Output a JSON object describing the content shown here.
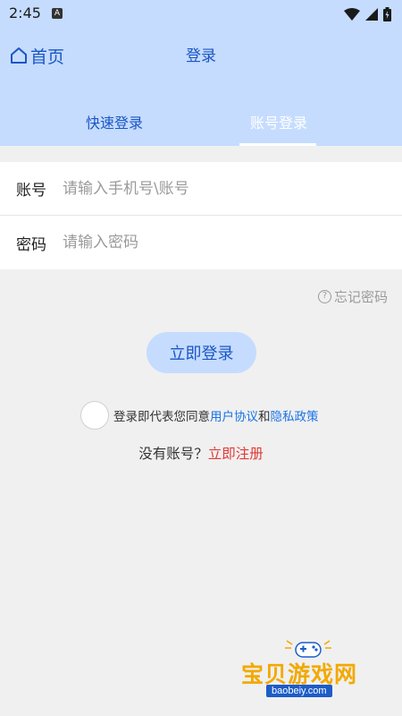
{
  "status_bar": {
    "time": "2:45",
    "notification_badge": "A",
    "icons": [
      "wifi-icon",
      "signal-icon",
      "battery-icon"
    ]
  },
  "header": {
    "home_label": "首页",
    "title": "登录",
    "background": "#c5dcff",
    "accent": "#1a56c4"
  },
  "tabs": [
    {
      "label": "快速登录",
      "active": false
    },
    {
      "label": "账号登录",
      "active": true
    }
  ],
  "form": {
    "account": {
      "label": "账号",
      "placeholder": "请输入手机号\\账号",
      "value": ""
    },
    "password": {
      "label": "密码",
      "placeholder": "请输入密码",
      "value": ""
    }
  },
  "forgot_label": "忘记密码",
  "login_button": "立即登录",
  "agreement": {
    "checked": false,
    "prefix": "登录即代表您同意",
    "user_agreement": "用户协议",
    "and": "和",
    "privacy_policy": "隐私政策"
  },
  "register": {
    "prompt": "没有账号？",
    "link": "立即注册"
  },
  "watermark": {
    "text": "宝贝游戏网",
    "url": "baobeiy.com"
  }
}
